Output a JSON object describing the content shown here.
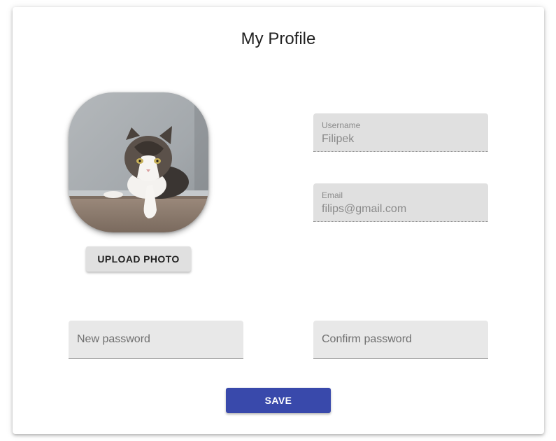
{
  "page": {
    "title": "My Profile"
  },
  "avatar": {
    "alt": "cat-photo"
  },
  "upload": {
    "label": "UPLOAD PHOTO"
  },
  "username": {
    "label": "Username",
    "value": "Filipek"
  },
  "email": {
    "label": "Email",
    "value": "filips@gmail.com"
  },
  "new_password": {
    "placeholder": "New password",
    "value": ""
  },
  "confirm_password": {
    "placeholder": "Confirm password",
    "value": ""
  },
  "save": {
    "label": "SAVE"
  },
  "colors": {
    "primary": "#3949ab",
    "field_background": "#e0e0e0",
    "card_background": "#ffffff"
  }
}
